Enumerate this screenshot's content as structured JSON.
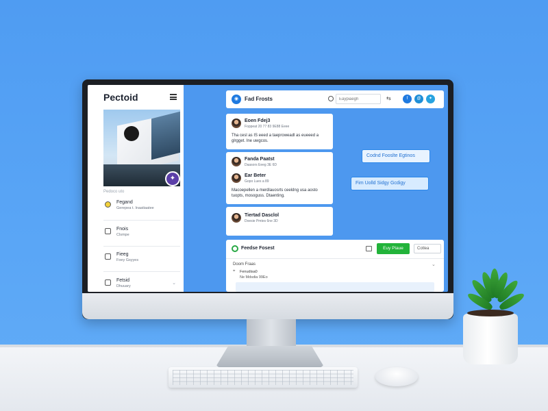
{
  "sidebar": {
    "brand": "Pectoid",
    "caption": "Pedoco uto",
    "items": [
      {
        "title": "Fegand",
        "subtitle": "Gerepea t. Inaatiaatee"
      },
      {
        "title": "Fnois",
        "subtitle": "Clsmpe"
      },
      {
        "title": "Fieeg",
        "subtitle": "Foey Gsyyes"
      },
      {
        "title": "Fetsid",
        "subtitle": "Dhuuary"
      }
    ]
  },
  "header": {
    "title": "Fad Frosts",
    "search_placeholder": "Eaypiaegh",
    "icon_colors": [
      "#1f7ae0",
      "#1f8fd8",
      "#27a3e0"
    ]
  },
  "posts": [
    {
      "name": "Eoen Fdej3",
      "meta": "Foppeat 20 77 83 9E88 Eeee",
      "body": "Tha cesl as IS eeed a taeproweadl as eueeed a glrgget. Ine uwgcos."
    },
    {
      "name": "Fanda Paatst",
      "meta": "Daasors  Eeeg 3E 6D",
      "reply_name": "Ear Beter",
      "reply_meta": "Gopo Lues a 89",
      "body": "Macoepellen a merdlauosrts ceeldng usa aosto tuopts, mosoguss. Dtaenting."
    },
    {
      "name": "Tiertad Dasclol",
      "meta": "Doesie Pmtes  6ne 3D"
    }
  ],
  "chips": [
    "Codnd Fooslte Egtinos",
    "Fim Uolld Sidgy Gcdigy"
  ],
  "lower_panel": {
    "title": "Feedse Fosest",
    "button": "Euy Plaue",
    "select": "Cotlea",
    "label": "Doom Fraas",
    "field": "Fenudisa0",
    "subfield": "Ne Mdsdia 99Eo"
  }
}
